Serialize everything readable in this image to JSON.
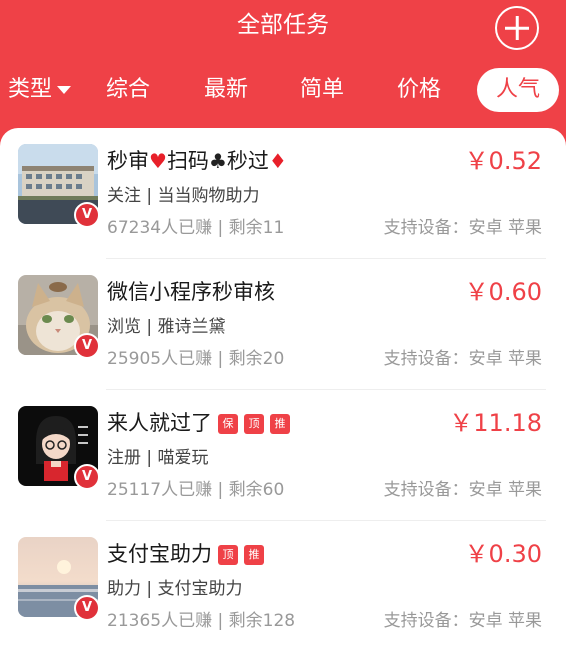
{
  "header": {
    "title": "全部任务",
    "add_icon": "plus-circle-icon"
  },
  "tabs": {
    "type_label": "类型",
    "items": [
      "综合",
      "最新",
      "简单",
      "价格",
      "人气"
    ],
    "active": "人气"
  },
  "tasks": [
    {
      "name_parts": [
        "秒审",
        "♥",
        "扫码",
        "♣",
        "秒过",
        "♦"
      ],
      "tags": [],
      "price": "￥0.52",
      "category": "关注 | 当当购物助力",
      "earned": "67234人已赚",
      "remaining": "剩余11",
      "devices": "支持设备：安卓 苹果",
      "thumb": "building-photo"
    },
    {
      "name": "微信小程序秒审核",
      "tags": [],
      "price": "￥0.60",
      "category": "浏览 | 雅诗兰黛",
      "earned": "25905人已赚",
      "remaining": "剩余20",
      "devices": "支持设备：安卓 苹果",
      "thumb": "cat-photo"
    },
    {
      "name": "来人就过了",
      "tags": [
        "保",
        "顶",
        "推"
      ],
      "price": "￥11.18",
      "category": "注册 | 喵爱玩",
      "earned": "25117人已赚",
      "remaining": "剩余60",
      "devices": "支持设备：安卓 苹果",
      "thumb": "cartoon-avatar"
    },
    {
      "name": "支付宝助力",
      "tags": [
        "顶",
        "推"
      ],
      "price": "￥0.30",
      "category": "助力 | 支付宝助力",
      "earned": "21365人已赚",
      "remaining": "剩余128",
      "devices": "支持设备：安卓 苹果",
      "thumb": "sunset-photo"
    }
  ],
  "badge_letter": "V",
  "colors": {
    "brand_red": "#ef4147",
    "heart": "#e8202a",
    "club": "#222222",
    "diamond": "#e8202a"
  }
}
